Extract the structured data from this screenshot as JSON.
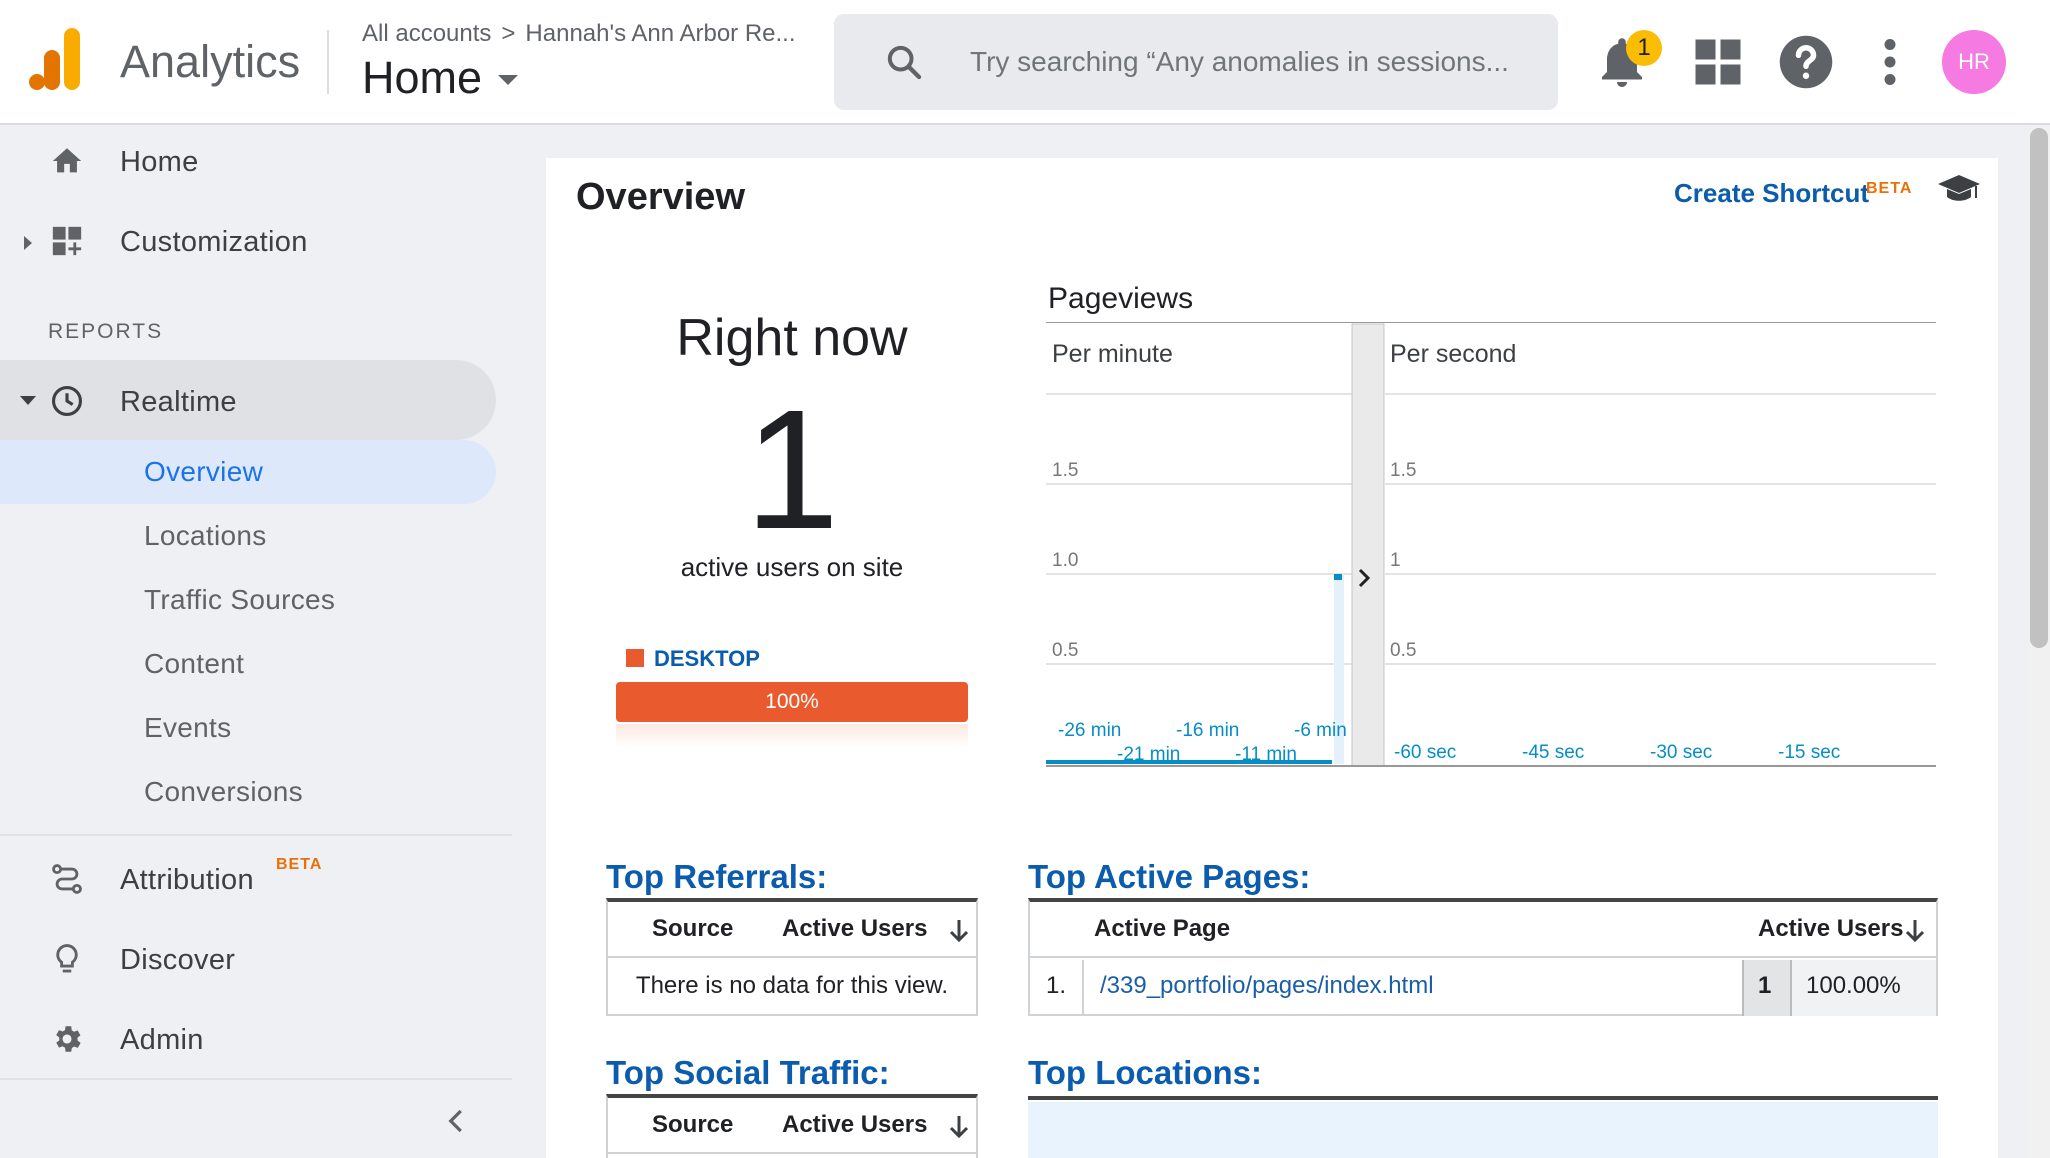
{
  "header": {
    "app_title": "Analytics",
    "breadcrumb": {
      "root": "All accounts",
      "separator": ">",
      "property": "Hannah's Ann Arbor Re..."
    },
    "view_title": "Home",
    "search_placeholder": "Try searching “Any anomalies in sessions...",
    "notification_count": "1",
    "avatar_initials": "HR",
    "icons": [
      "analytics-logo-icon",
      "search-icon",
      "bell-icon",
      "apps-grid-icon",
      "help-icon",
      "more-vert-icon"
    ],
    "colors": {
      "logo_orange": "#f9ab00",
      "logo_dark": "#e37400",
      "avatar_bg": "#f57ae1",
      "badge": "#fbbc04"
    }
  },
  "sidebar": {
    "top_items": [
      {
        "label": "Home",
        "icon": "home-icon"
      },
      {
        "label": "Customization",
        "icon": "dashboard-add-icon"
      }
    ],
    "reports_header": "REPORTS",
    "realtime": {
      "label": "Realtime",
      "icon": "clock-icon",
      "subitems": [
        {
          "label": "Overview",
          "active": true
        },
        {
          "label": "Locations"
        },
        {
          "label": "Traffic Sources"
        },
        {
          "label": "Content"
        },
        {
          "label": "Events"
        },
        {
          "label": "Conversions"
        }
      ]
    },
    "bottom_items": [
      {
        "label": "Attribution",
        "icon": "attribution-icon",
        "badge": "BETA"
      },
      {
        "label": "Discover",
        "icon": "lightbulb-icon"
      },
      {
        "label": "Admin",
        "icon": "gear-icon"
      }
    ]
  },
  "main": {
    "title": "Overview",
    "create_shortcut": "Create Shortcut",
    "shortcut_badge": "BETA",
    "right_now": {
      "title": "Right now",
      "count": "1",
      "subtitle": "active users on site",
      "device_label": "DESKTOP",
      "device_percent": "100%",
      "device_fraction": 1.0,
      "device_color": "#e95b2f"
    },
    "pageviews": {
      "title": "Pageviews",
      "per_minute_label": "Per minute",
      "per_second_label": "Per second"
    },
    "top_referrals": {
      "title": "Top Referrals:",
      "col_source": "Source",
      "col_users": "Active Users",
      "empty_text": "There is no data for this view."
    },
    "top_active_pages": {
      "title": "Top Active Pages:",
      "col_page": "Active Page",
      "col_users": "Active Users",
      "rows": [
        {
          "rank": "1.",
          "page": "/339_portfolio/pages/index.html",
          "users": "1",
          "percent": "100.00%"
        }
      ]
    },
    "top_social": {
      "title": "Top Social Traffic:",
      "col_source": "Source",
      "col_users": "Active Users"
    },
    "top_locations": {
      "title": "Top Locations:"
    }
  },
  "chart_data": [
    {
      "type": "bar",
      "title": "Pageviews",
      "subtitle": "Per minute",
      "categories": [
        "-26 min",
        "-21 min",
        "-16 min",
        "-11 min",
        "-6 min"
      ],
      "ytick_labels": [
        "0.5",
        "1.0",
        "1.5"
      ],
      "ylim": [
        0,
        2
      ],
      "series": [
        {
          "values": [
            0,
            0,
            0,
            0,
            1
          ]
        }
      ],
      "color": "#058dc7"
    },
    {
      "type": "bar",
      "subtitle": "Per second",
      "categories": [
        "-60 sec",
        "-45 sec",
        "-30 sec",
        "-15 sec"
      ],
      "ytick_labels": [
        "0.5",
        "1",
        "1.5"
      ],
      "ylim": [
        0,
        2
      ],
      "series": [
        {
          "values": [
            0,
            0,
            0,
            0
          ]
        }
      ],
      "color": "#058dc7"
    }
  ]
}
